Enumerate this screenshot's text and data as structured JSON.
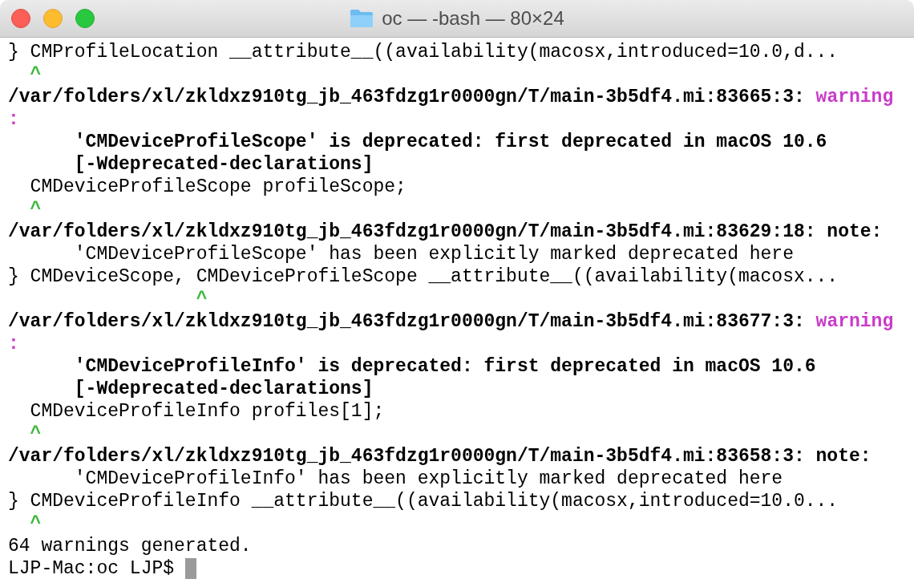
{
  "window": {
    "title": "oc — -bash — 80×24"
  },
  "lines": [
    [
      {
        "kind": "plain",
        "text": "} CMProfileLocation __attribute__((availability(macosx,introduced=10.0,d..."
      }
    ],
    [
      {
        "kind": "caret",
        "text": "  ^"
      }
    ],
    [
      {
        "kind": "bold",
        "text": "/var/folders/xl/zkldxz910tg_jb_463fdzg1r0000gn/T/main-3b5df4.mi:83665:3: "
      },
      {
        "kind": "warning",
        "text": "warning"
      }
    ],
    [
      {
        "kind": "warning",
        "text": ":"
      }
    ],
    [
      {
        "kind": "bold",
        "text": "      'CMDeviceProfileScope' is deprecated: first deprecated in macOS 10.6"
      }
    ],
    [
      {
        "kind": "bold",
        "text": "      [-Wdeprecated-declarations]"
      }
    ],
    [
      {
        "kind": "plain",
        "text": "  CMDeviceProfileScope profileScope;"
      }
    ],
    [
      {
        "kind": "caret",
        "text": "  ^"
      }
    ],
    [
      {
        "kind": "bold",
        "text": "/var/folders/xl/zkldxz910tg_jb_463fdzg1r0000gn/T/main-3b5df4.mi:83629:18: note:"
      }
    ],
    [
      {
        "kind": "plain",
        "text": "      'CMDeviceProfileScope' has been explicitly marked deprecated here"
      }
    ],
    [
      {
        "kind": "plain",
        "text": "} CMDeviceScope, CMDeviceProfileScope __attribute__((availability(macosx..."
      }
    ],
    [
      {
        "kind": "caret",
        "text": "                 ^"
      }
    ],
    [
      {
        "kind": "bold",
        "text": "/var/folders/xl/zkldxz910tg_jb_463fdzg1r0000gn/T/main-3b5df4.mi:83677:3: "
      },
      {
        "kind": "warning",
        "text": "warning"
      }
    ],
    [
      {
        "kind": "warning",
        "text": ":"
      }
    ],
    [
      {
        "kind": "bold",
        "text": "      'CMDeviceProfileInfo' is deprecated: first deprecated in macOS 10.6"
      }
    ],
    [
      {
        "kind": "bold",
        "text": "      [-Wdeprecated-declarations]"
      }
    ],
    [
      {
        "kind": "plain",
        "text": "  CMDeviceProfileInfo profiles[1];"
      }
    ],
    [
      {
        "kind": "caret",
        "text": "  ^"
      }
    ],
    [
      {
        "kind": "bold",
        "text": "/var/folders/xl/zkldxz910tg_jb_463fdzg1r0000gn/T/main-3b5df4.mi:83658:3: note:"
      }
    ],
    [
      {
        "kind": "plain",
        "text": "      'CMDeviceProfileInfo' has been explicitly marked deprecated here"
      }
    ],
    [
      {
        "kind": "plain",
        "text": "} CMDeviceProfileInfo __attribute__((availability(macosx,introduced=10.0..."
      }
    ],
    [
      {
        "kind": "caret",
        "text": "  ^"
      }
    ],
    [
      {
        "kind": "plain",
        "text": "64 warnings generated."
      }
    ],
    [
      {
        "kind": "prompt",
        "text": "LJP-Mac:oc LJP$ "
      }
    ]
  ]
}
